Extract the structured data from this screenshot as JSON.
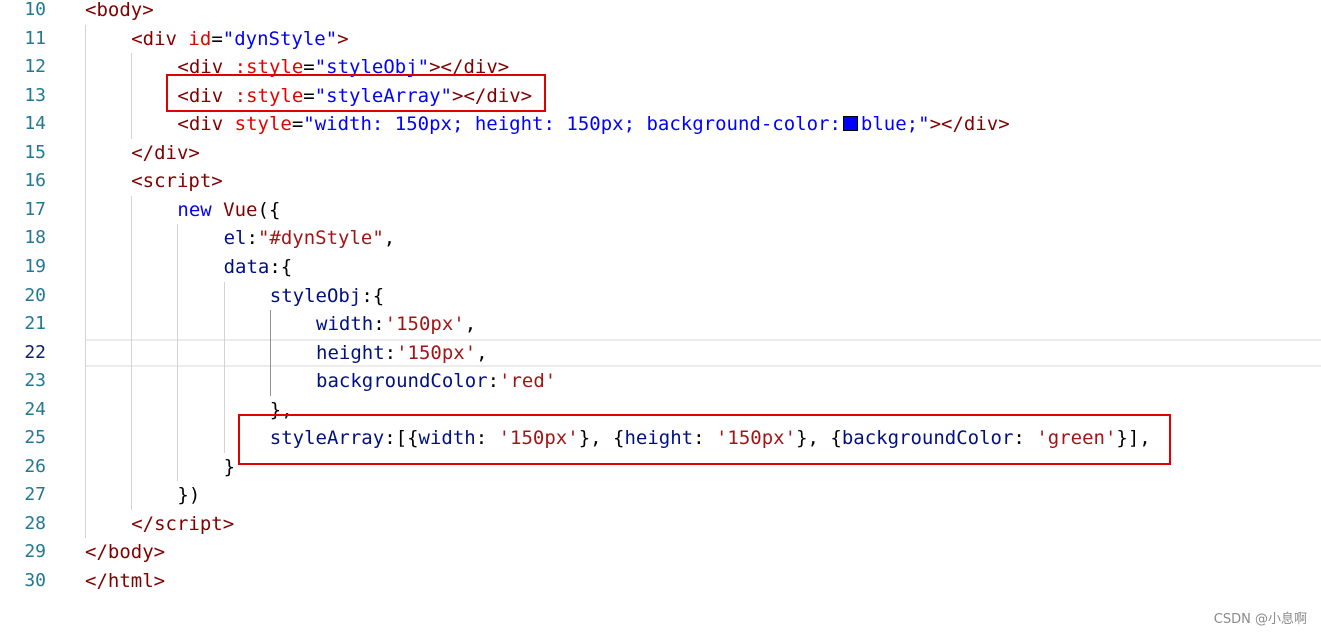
{
  "colors": {
    "tag": "#800000",
    "attr": "#e50000",
    "string": "#0000ff",
    "js_string": "#a31515",
    "keyword": "#0000ff",
    "identifier": "#001080",
    "plain": "#000000",
    "line_number": "#237893",
    "css_property": "#e50000",
    "highlight_box": "#e00000",
    "swatch": "#0000ff"
  },
  "editor": {
    "current_line": 22,
    "lines": [
      {
        "number": "10",
        "indent": 0,
        "tokens": [
          {
            "t": "<",
            "c": "tag"
          },
          {
            "t": "body",
            "c": "tag"
          },
          {
            "t": ">",
            "c": "tag"
          }
        ]
      },
      {
        "number": "11",
        "indent": 1,
        "tokens": [
          {
            "t": "<",
            "c": "tag"
          },
          {
            "t": "div",
            "c": "tag"
          },
          {
            "t": " ",
            "c": "plain"
          },
          {
            "t": "id",
            "c": "attr"
          },
          {
            "t": "=",
            "c": "plain"
          },
          {
            "t": "\"dynStyle\"",
            "c": "string"
          },
          {
            "t": ">",
            "c": "tag"
          }
        ]
      },
      {
        "number": "12",
        "indent": 2,
        "tokens": [
          {
            "t": "<",
            "c": "tag"
          },
          {
            "t": "div",
            "c": "tag"
          },
          {
            "t": " ",
            "c": "plain"
          },
          {
            "t": ":style",
            "c": "attr"
          },
          {
            "t": "=",
            "c": "plain"
          },
          {
            "t": "\"styleObj\"",
            "c": "string"
          },
          {
            "t": "></",
            "c": "tag"
          },
          {
            "t": "div",
            "c": "tag"
          },
          {
            "t": ">",
            "c": "tag"
          }
        ]
      },
      {
        "number": "13",
        "indent": 2,
        "tokens": [
          {
            "t": "<",
            "c": "tag"
          },
          {
            "t": "div",
            "c": "tag"
          },
          {
            "t": " ",
            "c": "plain"
          },
          {
            "t": ":style",
            "c": "attr"
          },
          {
            "t": "=",
            "c": "plain"
          },
          {
            "t": "\"styleArray\"",
            "c": "string"
          },
          {
            "t": "></",
            "c": "tag"
          },
          {
            "t": "div",
            "c": "tag"
          },
          {
            "t": ">",
            "c": "tag"
          }
        ]
      },
      {
        "number": "14",
        "indent": 2,
        "tokens": [
          {
            "t": "<",
            "c": "tag"
          },
          {
            "t": "div",
            "c": "tag"
          },
          {
            "t": " ",
            "c": "plain"
          },
          {
            "t": "style",
            "c": "attr"
          },
          {
            "t": "=",
            "c": "plain"
          },
          {
            "t": "\"width: 150px; height: 150px; background-color:",
            "c": "string"
          },
          {
            "t": "",
            "c": "swatch"
          },
          {
            "t": "blue;\"",
            "c": "string"
          },
          {
            "t": "></",
            "c": "tag"
          },
          {
            "t": "div",
            "c": "tag"
          },
          {
            "t": ">",
            "c": "tag"
          }
        ]
      },
      {
        "number": "15",
        "indent": 1,
        "tokens": [
          {
            "t": "</",
            "c": "tag"
          },
          {
            "t": "div",
            "c": "tag"
          },
          {
            "t": ">",
            "c": "tag"
          }
        ]
      },
      {
        "number": "16",
        "indent": 1,
        "tokens": [
          {
            "t": "<",
            "c": "tag"
          },
          {
            "t": "script",
            "c": "tag"
          },
          {
            "t": ">",
            "c": "tag"
          }
        ]
      },
      {
        "number": "17",
        "indent": 2,
        "tokens": [
          {
            "t": "new",
            "c": "keyword"
          },
          {
            "t": " ",
            "c": "plain"
          },
          {
            "t": "Vue",
            "c": "tag"
          },
          {
            "t": "({",
            "c": "plain"
          }
        ]
      },
      {
        "number": "18",
        "indent": 3,
        "tokens": [
          {
            "t": "el",
            "c": "identifier"
          },
          {
            "t": ":",
            "c": "plain"
          },
          {
            "t": "\"#dynStyle\"",
            "c": "js_string"
          },
          {
            "t": ",",
            "c": "plain"
          }
        ]
      },
      {
        "number": "19",
        "indent": 3,
        "tokens": [
          {
            "t": "data",
            "c": "identifier"
          },
          {
            "t": ":{",
            "c": "plain"
          }
        ]
      },
      {
        "number": "20",
        "indent": 4,
        "tokens": [
          {
            "t": "styleObj",
            "c": "identifier"
          },
          {
            "t": ":{",
            "c": "plain"
          }
        ]
      },
      {
        "number": "21",
        "indent": 5,
        "tokens": [
          {
            "t": "width",
            "c": "identifier"
          },
          {
            "t": ":",
            "c": "plain"
          },
          {
            "t": "'150px'",
            "c": "js_string"
          },
          {
            "t": ",",
            "c": "plain"
          }
        ]
      },
      {
        "number": "22",
        "indent": 5,
        "tokens": [
          {
            "t": "height",
            "c": "identifier"
          },
          {
            "t": ":",
            "c": "plain"
          },
          {
            "t": "'150px'",
            "c": "js_string"
          },
          {
            "t": ",",
            "c": "plain"
          }
        ]
      },
      {
        "number": "23",
        "indent": 5,
        "tokens": [
          {
            "t": "backgroundColor",
            "c": "identifier"
          },
          {
            "t": ":",
            "c": "plain"
          },
          {
            "t": "'red'",
            "c": "js_string"
          }
        ]
      },
      {
        "number": "24",
        "indent": 4,
        "tokens": [
          {
            "t": "},",
            "c": "plain"
          }
        ]
      },
      {
        "number": "25",
        "indent": 4,
        "tokens": [
          {
            "t": "styleArray",
            "c": "identifier"
          },
          {
            "t": ":[{",
            "c": "plain"
          },
          {
            "t": "width",
            "c": "identifier"
          },
          {
            "t": ": ",
            "c": "plain"
          },
          {
            "t": "'150px'",
            "c": "js_string"
          },
          {
            "t": "}, {",
            "c": "plain"
          },
          {
            "t": "height",
            "c": "identifier"
          },
          {
            "t": ": ",
            "c": "plain"
          },
          {
            "t": "'150px'",
            "c": "js_string"
          },
          {
            "t": "}, {",
            "c": "plain"
          },
          {
            "t": "backgroundColor",
            "c": "identifier"
          },
          {
            "t": ": ",
            "c": "plain"
          },
          {
            "t": "'green'",
            "c": "js_string"
          },
          {
            "t": "}],",
            "c": "plain"
          }
        ]
      },
      {
        "number": "26",
        "indent": 3,
        "tokens": [
          {
            "t": "}",
            "c": "plain"
          }
        ]
      },
      {
        "number": "27",
        "indent": 2,
        "tokens": [
          {
            "t": "})",
            "c": "plain"
          }
        ]
      },
      {
        "number": "28",
        "indent": 1,
        "tokens": [
          {
            "t": "</",
            "c": "tag"
          },
          {
            "t": "script",
            "c": "tag"
          },
          {
            "t": ">",
            "c": "tag"
          }
        ]
      },
      {
        "number": "29",
        "indent": 0,
        "tokens": [
          {
            "t": "</",
            "c": "tag"
          },
          {
            "t": "body",
            "c": "tag"
          },
          {
            "t": ">",
            "c": "tag"
          }
        ]
      },
      {
        "number": "30",
        "indent": 0,
        "tokens": [
          {
            "t": "</",
            "c": "tag"
          },
          {
            "t": "html",
            "c": "tag"
          },
          {
            "t": ">",
            "c": "tag"
          }
        ]
      }
    ]
  },
  "watermark": {
    "text": "CSDN @小息啊"
  }
}
